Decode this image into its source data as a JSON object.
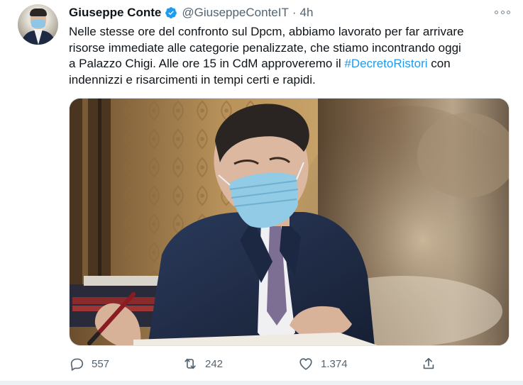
{
  "author": {
    "name": "Giuseppe Conte",
    "handle": "@GiuseppeConteIT",
    "separator": "·",
    "time": "4h",
    "verified_color": "#1d9bf0"
  },
  "tweet": {
    "lines": [
      "Nelle stesse ore del confronto sul Dpcm, abbiamo lavorato per far arrivare",
      "risorse immediate alle categorie penalizzate, che stiamo incontrando oggi",
      "a Palazzo Chigi. Alle ore 15 in CdM approveremo il "
    ],
    "hashtag": "#DecretoRistori",
    "line3_after": " con",
    "line4": "indennizzi e risarcimenti in tempi certi e rapidi."
  },
  "stats": {
    "replies": "557",
    "retweets": "242",
    "likes": "1.374"
  },
  "icons": {
    "reply": "reply-icon",
    "retweet": "retweet-icon",
    "like": "heart-icon",
    "share": "share-icon",
    "more": "more-icon"
  },
  "colors": {
    "text": "#0f1419",
    "secondary": "#536471",
    "link": "#1d9bf0"
  }
}
